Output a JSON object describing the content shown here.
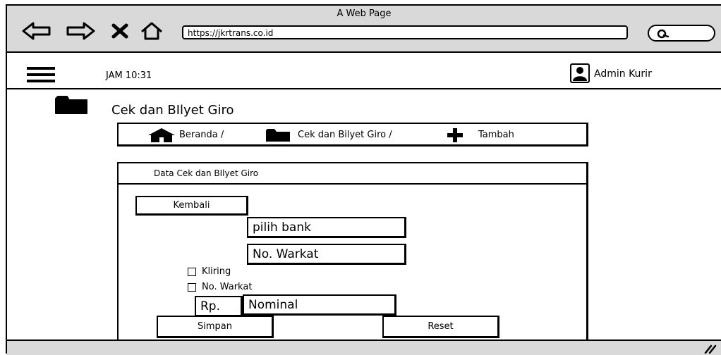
{
  "window": {
    "title": "A Web Page"
  },
  "browser": {
    "url": "https://jkrtrans.co.id"
  },
  "appbar": {
    "clock": "JAM 10:31",
    "user": "Admin Kurir"
  },
  "page": {
    "title": "Cek dan BIlyet Giro"
  },
  "breadcrumb": {
    "home": "Beranda /",
    "section": "Cek dan Bilyet Giro /",
    "current": "Tambah"
  },
  "form": {
    "panel_title": "Data Cek dan BIlyet Giro",
    "back_label": "Kembali",
    "bank_placeholder": "pilih bank",
    "warkat_placeholder": "No. Warkat",
    "options": [
      "Kliring",
      "No. Warkat"
    ],
    "currency": "Rp.",
    "nominal_placeholder": "Nominal",
    "save_label": "Simpan",
    "reset_label": "Reset"
  }
}
